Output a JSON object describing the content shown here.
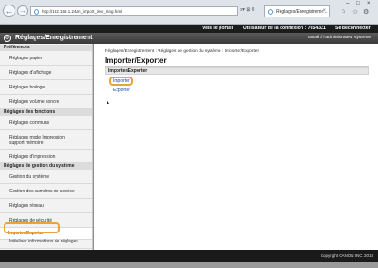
{
  "browser": {
    "back_glyph": "←",
    "forward_glyph": "→",
    "url": "http://192.168.1.24/m_import_dev_rsng.html",
    "address_controls": "ρ▾ ⊠ ¢",
    "tab_title": "Réglages/Enregistreme...",
    "tab_close": "×",
    "window_minimize": "–",
    "window_restore": "□",
    "window_close": "×",
    "tools_home": "⌂",
    "tools_favorites": "☆",
    "tools_settings": "⚙"
  },
  "topbar": {
    "portal_link": "Vers le portail",
    "user_label": "Utilisateur de la connexion : 7654321",
    "logout_link": "Se déconnecter"
  },
  "header": {
    "logo_glyph": "⚙",
    "title": "Réglages/Enregistrement",
    "logged_in_as": "Email à l'administrateur système"
  },
  "sidebar": {
    "sections": [
      {
        "title": "Préférences",
        "items": [
          "Réglages papier",
          "Réglages d'affichage",
          "Réglages horloge",
          "Réglages volume sonore"
        ]
      },
      {
        "title": "Réglages des fonctions",
        "items": [
          "Réglages communs",
          "Réglages mode Impression support mémoire",
          "Réglages d'impression"
        ]
      },
      {
        "title": "Réglages de gestion du système",
        "items": [
          "Gestion du système",
          "Gestion des numéros de service",
          "Réglages réseau",
          "Réglages de sécurité",
          "Importer/Exporter",
          "Initialiser informations de réglages"
        ]
      }
    ]
  },
  "content": {
    "breadcrumb": "Réglages/Enregistrement : Réglages de gestion du système : Importer/Exporter",
    "page_title": "Importer/Exporter",
    "box_header": "Importer/Exporter",
    "import_link": "Importer",
    "export_link": "Exporter",
    "top_arrow": "▲"
  },
  "footer": {
    "copyright": "Copyright CANON INC. 2015"
  },
  "colors": {
    "highlight": "#e8a33a",
    "link": "#1a4fa3",
    "header_dark": "#1c1c1c"
  }
}
